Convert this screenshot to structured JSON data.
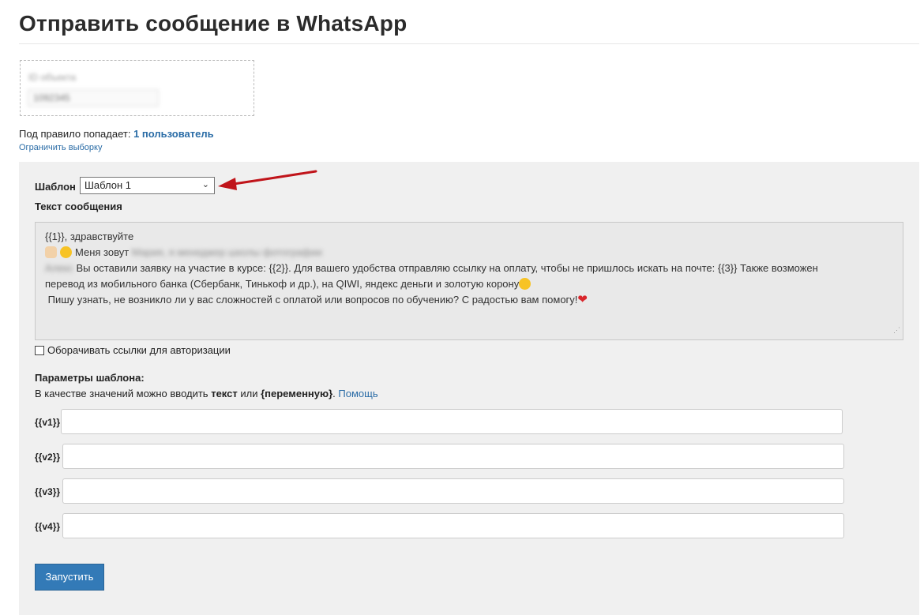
{
  "page": {
    "title": "Отправить сообщение в WhatsApp"
  },
  "filter": {
    "label": "ID объекта",
    "value": "1092345"
  },
  "rule": {
    "prefix": "Под правило попадает: ",
    "count": "1 пользователь",
    "restrict_link": "Ограничить выборку"
  },
  "form": {
    "template_label": "Шаблон",
    "template_selected": "Шаблон 1",
    "message_label": "Текст сообщения",
    "message": {
      "line1": "{{1}}, здравствуйте",
      "line2_text": "Меня зовут ",
      "line2_blurred": "Мария, я менеджер школы фотографии",
      "line3_blurred": "Алекс",
      "line3_text": " Вы оставили заявку на участие в курсе: {{2}}. Для вашего удобства отправляю ссылку на оплату, чтобы не пришлось искать на почте: {{3}} Также возможен",
      "line4_text": "перевод из мобильного банка (Сбербанк, Тинькоф и др.), на QIWI, яндекс деньги и золотую корону",
      "line5_text": " Пишу узнать, не возникло ли у вас сложностей с оплатой или вопросов по обучению? С радостью вам помогу!",
      "heart": "❤"
    },
    "wrap_links_label": "Оборачивать ссылки для авторизации",
    "params_title": "Параметры шаблона:",
    "params_hint": {
      "prefix": "В качестве значений можно вводить ",
      "text_word": "текст",
      "or": " или ",
      "var_word": "{переменную}",
      "dot": ". ",
      "help": "Помощь"
    },
    "params": [
      {
        "label": "{{v1}}",
        "value": ""
      },
      {
        "label": "{{v2}}",
        "value": ""
      },
      {
        "label": "{{v3}}",
        "value": ""
      },
      {
        "label": "{{v4}}",
        "value": ""
      }
    ],
    "submit_label": "Запустить"
  },
  "colors": {
    "accent": "#337ab7",
    "link": "#2a6ca6",
    "arrow": "#c0141a",
    "panel": "#f0f0f0"
  }
}
